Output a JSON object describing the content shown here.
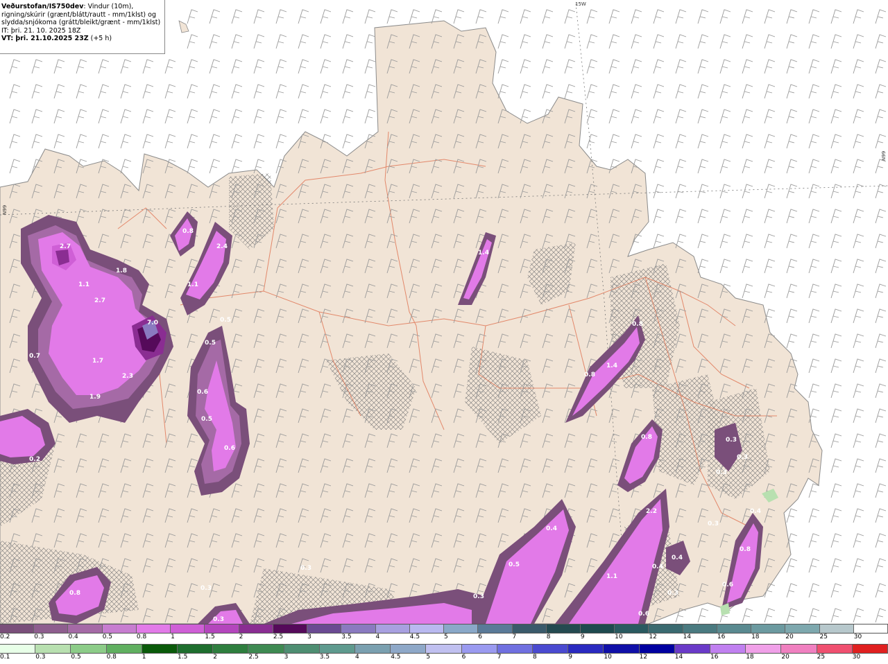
{
  "title": {
    "brand": "Veðurstofan/IS750dev",
    "line1": ": Vindur (10m),",
    "line2": "rigning/skúrir (grænt/blátt/rautt - mm/1klst) og",
    "line3": "slydda/snjókoma (grátt/bleikt/grænt - mm/1klst)",
    "it": "IT: þri. 21. 10. 2025 18Z",
    "vt": "VT: þri. 21.10.2025 23Z",
    "vt_offset": "(+5 h)"
  },
  "grid_labels": {
    "lon": "15W",
    "lat_left": "N99",
    "lat_right": "N99"
  },
  "map_values": [
    "2.7",
    "1.8",
    "1.1",
    "2.7",
    "7.0",
    "1.7",
    "2.3",
    "1.9",
    "0.7",
    "0.8",
    "2.4",
    "1.1",
    "0.5",
    "0.5",
    "0.6",
    "0.5",
    "0.6",
    "1.4",
    "0.8",
    "1.4",
    "0.8",
    "0.8",
    "0.3",
    "0.3",
    "0.3",
    "0.3",
    "0.3",
    "2.2",
    "0.4",
    "0.5",
    "1.1",
    "0.4",
    "0.4",
    "0.3",
    "0.6",
    "0.4",
    "0.8",
    "0.6",
    "0.3",
    "0.3",
    "0.8",
    "0.2",
    "0.3"
  ],
  "legend_snow": {
    "labels": [
      "0.2",
      "0.3",
      "0.4",
      "0.5",
      "0.8",
      "1",
      "1.5",
      "2",
      "2.5",
      "3",
      "3.5",
      "4",
      "4.5",
      "5",
      "6",
      "7",
      "8",
      "9",
      "10",
      "12",
      "14",
      "16",
      "18",
      "20",
      "25",
      "30"
    ],
    "colors": [
      "#7a4f7a",
      "#8e5e8e",
      "#a56aa6",
      "#c77dd0",
      "#e27ae8",
      "#cf5fd6",
      "#b446bd",
      "#8a2d92",
      "#550a5a",
      "#6a4a92",
      "#8a7ac0",
      "#a8a0e0",
      "#b9b9f0",
      "#8aa8c8",
      "#5a7a98",
      "#3a5a6a",
      "#244a50",
      "#1e4a4e",
      "#2a5a60",
      "#3a6a70",
      "#4a7a80",
      "#5a8a90",
      "#6c9aa0",
      "#7ea8ae",
      "#b7c8cc",
      "#ffffff"
    ]
  },
  "legend_rain": {
    "labels": [
      "0.1",
      "0.3",
      "0.5",
      "0.8",
      "1",
      "1.5",
      "2",
      "2.5",
      "3",
      "3.5",
      "4",
      "4.5",
      "5",
      "6",
      "7",
      "8",
      "9",
      "10",
      "12",
      "14",
      "16",
      "18",
      "20",
      "25",
      "30"
    ],
    "colors": [
      "#e8ffe8",
      "#b8e0b0",
      "#8ccc88",
      "#60b060",
      "#0a5a0a",
      "#1e6e2e",
      "#2e7e3e",
      "#3e8a52",
      "#4e8e72",
      "#5e9a8e",
      "#7aa0b0",
      "#8ea8c8",
      "#c0c0f0",
      "#9a9af0",
      "#7070e0",
      "#4a4ad0",
      "#2a2ac0",
      "#1010a8",
      "#0000a0",
      "#6a3ac8",
      "#c080f0",
      "#f0a0e8",
      "#f080c0",
      "#f05070",
      "#e02020"
    ]
  },
  "colors": {
    "land": "#f1e4d6",
    "sea": "#ffffff",
    "roads": "#e07858",
    "wind": "#9a9a9a",
    "coast": "#8a8a8a"
  }
}
